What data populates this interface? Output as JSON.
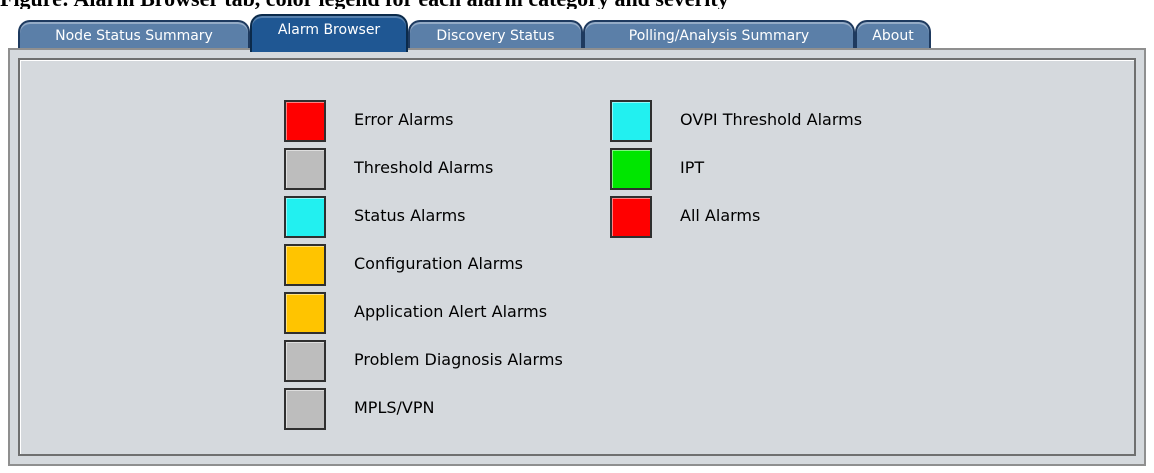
{
  "window": {
    "top_heading": "Figure: Alarm Browser tab, color legend for each alarm category and severity"
  },
  "tabs": [
    {
      "label": "Node Status Summary"
    },
    {
      "label": "Alarm Browser"
    },
    {
      "label": "Discovery Status"
    },
    {
      "label": "Polling/Analysis Summary"
    },
    {
      "label": "About"
    }
  ],
  "alarm_browser": {
    "left_items": [
      {
        "label": "Error Alarms",
        "color": "#ff0000"
      },
      {
        "label": "Threshold Alarms",
        "color": "#bdbdbd"
      },
      {
        "label": "Status Alarms",
        "color": "#22f0f0"
      },
      {
        "label": "Configuration Alarms",
        "color": "#ffc400"
      },
      {
        "label": "Application Alert Alarms",
        "color": "#ffc400"
      },
      {
        "label": "Problem Diagnosis Alarms",
        "color": "#bdbdbd"
      },
      {
        "label": "MPLS/VPN",
        "color": "#bdbdbd"
      }
    ],
    "right_items": [
      {
        "label": "OVPI Threshold Alarms",
        "color": "#22f0f0"
      },
      {
        "label": "IPT",
        "color": "#00e600"
      },
      {
        "label": "All Alarms",
        "color": "#ff0000"
      }
    ]
  }
}
